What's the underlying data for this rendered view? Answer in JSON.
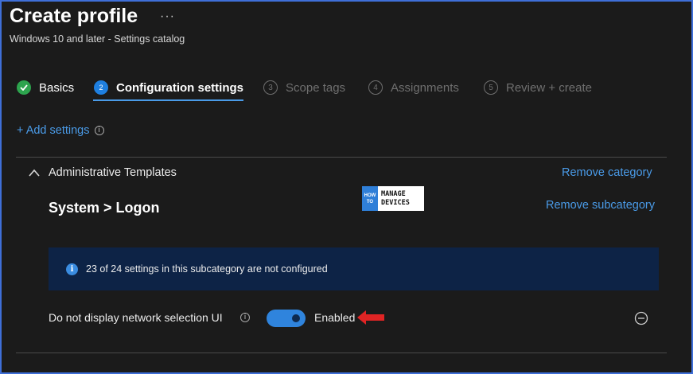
{
  "header": {
    "title": "Create profile",
    "more": "···",
    "subtitle": "Windows 10 and later - Settings catalog"
  },
  "steps": [
    {
      "number": "1",
      "label": "Basics",
      "state": "done"
    },
    {
      "number": "2",
      "label": "Configuration settings",
      "state": "active"
    },
    {
      "number": "3",
      "label": "Scope tags",
      "state": "pending"
    },
    {
      "number": "4",
      "label": "Assignments",
      "state": "pending"
    },
    {
      "number": "5",
      "label": "Review + create",
      "state": "pending"
    }
  ],
  "add_settings_label": "+ Add settings",
  "category": {
    "title": "Administrative Templates",
    "remove_label": "Remove category"
  },
  "subcategory": {
    "title": "System > Logon",
    "remove_label": "Remove subcategory"
  },
  "watermark": {
    "left_top": "HOW",
    "left_bottom": "TO",
    "right_top": "MANAGE",
    "right_bottom": "DEVICES"
  },
  "info_banner": {
    "text": "23 of 24 settings in this subcategory are not configured"
  },
  "setting": {
    "label": "Do not display network selection UI",
    "value": "Enabled",
    "enabled": true
  },
  "colors": {
    "accent": "#4a9be8",
    "success": "#2da44e",
    "toggle_on": "#2f84dd",
    "banner_bg": "#0d2346",
    "annotation_arrow": "#e02424"
  },
  "icons": {
    "info": "info-icon",
    "chevron": "chevron-up-icon",
    "remove": "minus-circle-icon",
    "check": "check-icon"
  }
}
